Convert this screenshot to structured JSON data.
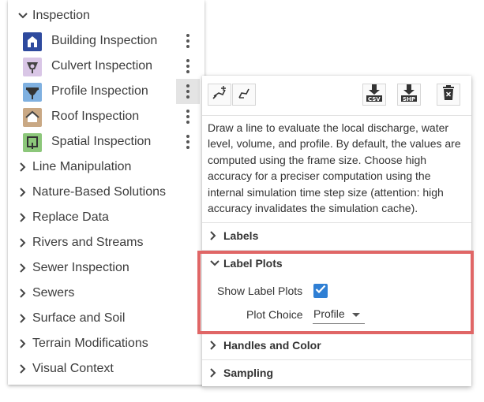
{
  "tree": {
    "inspection": {
      "label": "Inspection",
      "children": [
        {
          "label": "Building Inspection",
          "icon": "building-inspection-icon",
          "color": "#2e4a9e"
        },
        {
          "label": "Culvert Inspection",
          "icon": "culvert-inspection-icon",
          "color": "#d9c6e6"
        },
        {
          "label": "Profile Inspection",
          "icon": "profile-inspection-icon",
          "color": "#7fb0e0"
        },
        {
          "label": "Roof Inspection",
          "icon": "roof-inspection-icon",
          "color": "#c9a884"
        },
        {
          "label": "Spatial Inspection",
          "icon": "spatial-inspection-icon",
          "color": "#8cc77a"
        }
      ]
    },
    "categories": [
      "Line Manipulation",
      "Nature-Based Solutions",
      "Replace Data",
      "Rivers and Streams",
      "Sewer Inspection",
      "Sewers",
      "Surface and Soil",
      "Terrain Modifications",
      "Visual Context"
    ]
  },
  "popup": {
    "toolbar": {
      "draw_line_icon": "draw-line-icon",
      "edit_line_icon": "edit-line-icon",
      "csv_label": "CSV",
      "shp_label": "SHP",
      "delete_icon": "trash-icon"
    },
    "description": "Draw a line to evaluate the local discharge, water level, volume, and profile. By default, the values are computed using the frame size. Choose high accuracy for a preciser computation using the internal simulation time step size (attention: high accuracy invalidates the simulation cache).",
    "sections": {
      "labels": "Labels",
      "label_plots": "Label Plots",
      "handles_color": "Handles and Color",
      "sampling": "Sampling"
    },
    "label_plots": {
      "show_label": "Show Label Plots",
      "show_checked": true,
      "plot_choice_label": "Plot Choice",
      "plot_choice_value": "Profile"
    }
  },
  "colors": {
    "accent": "#2f7fd4",
    "highlight": "#e06666"
  }
}
